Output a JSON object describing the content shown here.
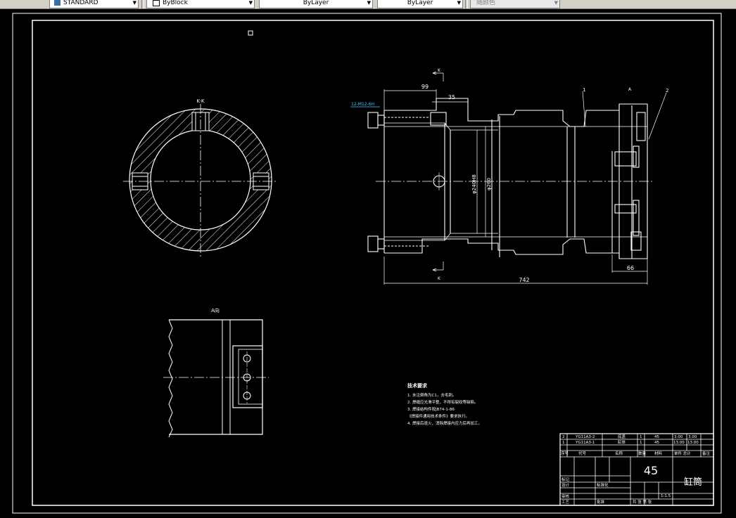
{
  "toolbar": {
    "style_value": "STANDARD",
    "color_value": "ByBlock",
    "linetype_value": "ByLayer",
    "lineweight_value": "ByLayer",
    "plotstyle_value": "随颜色"
  },
  "drawing": {
    "section_view_label": "K-K",
    "detail_view_label": "A向",
    "thread_callout": "12-M12-6H",
    "dim_99": "99",
    "dim_35": "35",
    "dim_742": "742",
    "dim_66": "66",
    "dim_bore_1": "φ240H8",
    "dim_bore_2": "φ260",
    "section_arrow_top": "K",
    "section_arrow_bottom": "K",
    "view_marker": "A",
    "balloon_1": "1",
    "balloon_2": "2",
    "tech_title": "技术要求",
    "tech_notes": [
      "1. 未注倒角为C1，去毛刺。",
      "2. 焊缝应光滑平整，不得有裂纹等缺陷。",
      "3. 焊接结构件按JB74-1-86",
      "  《焊接件通用技术条件》要求执行。",
      "4. 焊接后退火，消除焊接内应力后再加工。"
    ]
  },
  "title_block": {
    "bom_rows": [
      {
        "no": "2",
        "code": "YG11A3-2",
        "name": "底盖",
        "qty": "1",
        "material": "45",
        "w1": "3.00",
        "w2": "3.00"
      },
      {
        "no": "1",
        "code": "YG11A3-1",
        "name": "缸体",
        "qty": "1",
        "material": "45",
        "w1": "13.00",
        "w2": "13.00"
      }
    ],
    "bom_headers": [
      "序号",
      "代号",
      "名称",
      "数量",
      "材料",
      "单件 总计",
      "备注"
    ],
    "material_big": "45",
    "part_name": "缸筒",
    "scale": "1:1.5",
    "sheet_label": "共 张 第 张",
    "rows_left": [
      "标记",
      "设计",
      "审核",
      "工艺"
    ],
    "std_label": "标准化",
    "approve_label": "批准"
  }
}
